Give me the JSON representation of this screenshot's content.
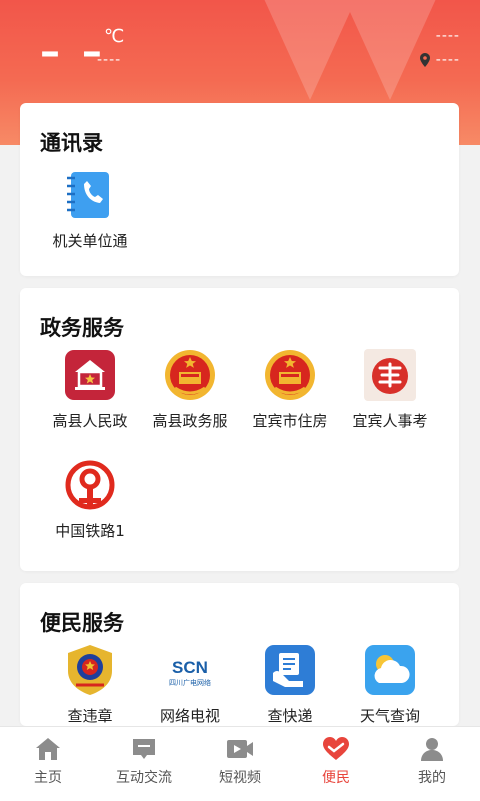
{
  "header": {
    "temp_value": "– –",
    "temp_unit": "℃",
    "weather_desc": "----",
    "date": "----",
    "location": "----"
  },
  "contacts": {
    "title": "通讯录",
    "items": [
      {
        "label": "机关单位通",
        "icon": "phone-book-icon"
      }
    ]
  },
  "gov": {
    "title": "政务服务",
    "items": [
      {
        "label": "高县人民政",
        "icon": "government-house-icon"
      },
      {
        "label": "高县政务服",
        "icon": "national-emblem-icon"
      },
      {
        "label": "宜宾市住房",
        "icon": "national-emblem-icon"
      },
      {
        "label": "宜宾人事考",
        "icon": "seal-stamp-icon"
      },
      {
        "label": "中国铁路1",
        "icon": "china-railway-icon"
      }
    ]
  },
  "convenience": {
    "title": "便民服务",
    "items": [
      {
        "label": "查违章",
        "icon": "police-badge-icon"
      },
      {
        "label": "网络电视",
        "icon": "scn-logo-icon"
      },
      {
        "label": "查快递",
        "icon": "express-delivery-icon"
      },
      {
        "label": "天气查询",
        "icon": "weather-icon"
      }
    ]
  },
  "scn_logo": {
    "main": "SCN",
    "sub": "四川广电网络"
  },
  "tabbar": {
    "tabs": [
      {
        "label": "主页",
        "icon": "home-icon",
        "active": false
      },
      {
        "label": "互动交流",
        "icon": "chat-icon",
        "active": false
      },
      {
        "label": "短视频",
        "icon": "video-icon",
        "active": false
      },
      {
        "label": "便民",
        "icon": "heart-hand-icon",
        "active": true
      },
      {
        "label": "我的",
        "icon": "user-icon",
        "active": false
      }
    ]
  },
  "colors": {
    "accent": "#e8453c",
    "header_top": "#f2564a",
    "header_bottom": "#f78a66"
  }
}
